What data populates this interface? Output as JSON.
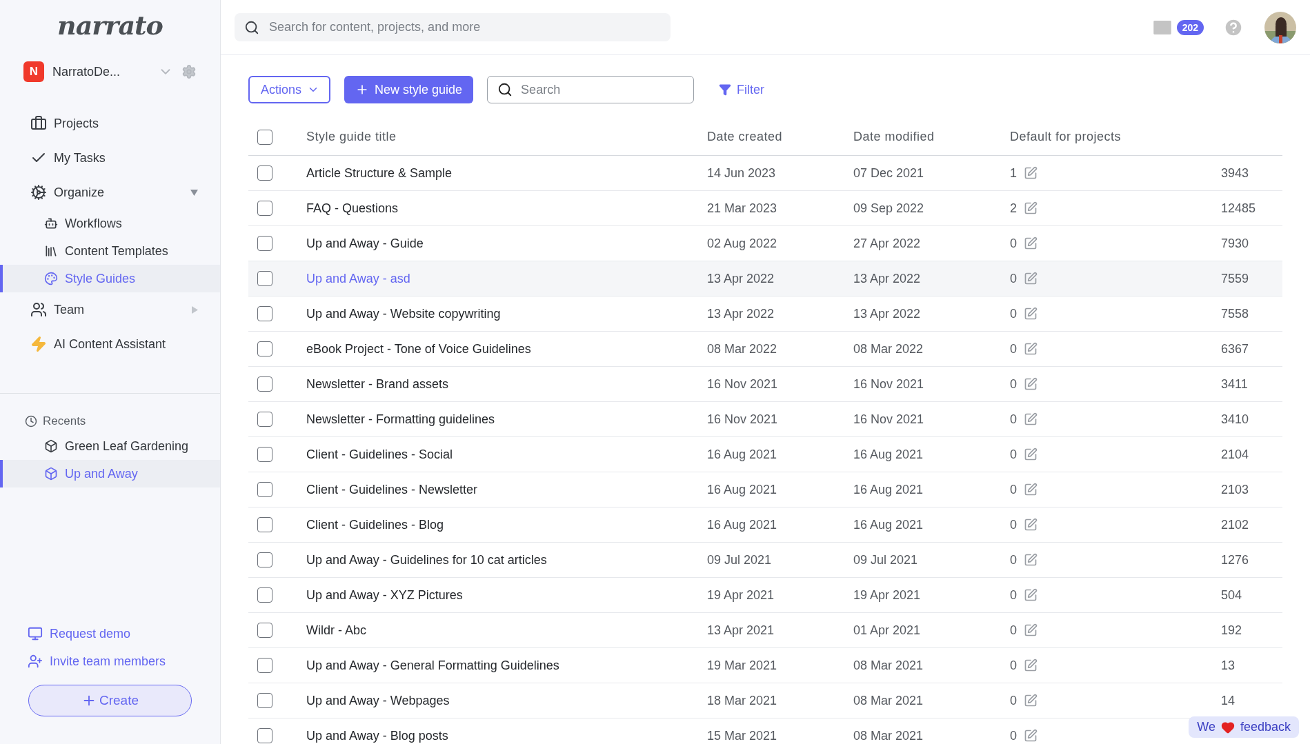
{
  "logo": "narrato",
  "workspace": {
    "initial": "N",
    "name": "NarratoDe..."
  },
  "nav": [
    {
      "kind": "item",
      "label": "Projects",
      "selected": false
    },
    {
      "kind": "item",
      "label": "My Tasks",
      "selected": false
    },
    {
      "kind": "group",
      "label": "Organize",
      "expanded": true,
      "children": [
        {
          "label": "Workflows",
          "selected": false
        },
        {
          "label": "Content Templates",
          "selected": false
        },
        {
          "label": "Style Guides",
          "selected": true
        }
      ]
    },
    {
      "kind": "group",
      "label": "Team",
      "expanded": false
    },
    {
      "kind": "item",
      "label": "AI Content Assistant",
      "selected": false
    }
  ],
  "recents": {
    "title": "Recents",
    "items": [
      {
        "label": "Green Leaf Gardening",
        "selected": false
      },
      {
        "label": "Up and Away",
        "selected": true
      }
    ]
  },
  "links": [
    "Request demo",
    "Invite team members"
  ],
  "create_button": "Create",
  "topbar": {
    "search_placeholder": "Search for content, projects, and more",
    "mail_count": "202"
  },
  "toolbar": {
    "actions": "Actions",
    "new_button": "New style guide",
    "search_placeholder": "Search",
    "filter": "Filter"
  },
  "table": {
    "select_all_checked": false,
    "columns": [
      "Style guide title",
      "Date created",
      "Date modified",
      "Default for projects"
    ],
    "rows": [
      {
        "title": "Article Structure & Sample",
        "created": "14 Jun 2023",
        "modified": "07 Dec 2021",
        "default": "1",
        "column_5": "3943",
        "checked": false,
        "highlighted": false
      },
      {
        "title": "FAQ - Questions",
        "created": "21 Mar 2023",
        "modified": "09 Sep 2022",
        "default": "2",
        "column_5": "12485",
        "checked": false,
        "highlighted": false
      },
      {
        "title": "Up and Away - Guide",
        "created": "02 Aug 2022",
        "modified": "27 Apr 2022",
        "default": "0",
        "column_5": "7930",
        "checked": false,
        "highlighted": false
      },
      {
        "title": "Up and Away - asd",
        "created": "13 Apr 2022",
        "modified": "13 Apr 2022",
        "default": "0",
        "column_5": "7559",
        "checked": false,
        "highlighted": true
      },
      {
        "title": "Up and Away - Website copywriting",
        "created": "13 Apr 2022",
        "modified": "13 Apr 2022",
        "default": "0",
        "column_5": "7558",
        "checked": false,
        "highlighted": false
      },
      {
        "title": "eBook Project - Tone of Voice Guidelines",
        "created": "08 Mar 2022",
        "modified": "08 Mar 2022",
        "default": "0",
        "column_5": "6367",
        "checked": false,
        "highlighted": false
      },
      {
        "title": "Newsletter - Brand assets",
        "created": "16 Nov 2021",
        "modified": "16 Nov 2021",
        "default": "0",
        "column_5": "3411",
        "checked": false,
        "highlighted": false
      },
      {
        "title": "Newsletter - Formatting guidelines",
        "created": "16 Nov 2021",
        "modified": "16 Nov 2021",
        "default": "0",
        "column_5": "3410",
        "checked": false,
        "highlighted": false
      },
      {
        "title": "Client - Guidelines - Social",
        "created": "16 Aug 2021",
        "modified": "16 Aug 2021",
        "default": "0",
        "column_5": "2104",
        "checked": false,
        "highlighted": false
      },
      {
        "title": "Client - Guidelines - Newsletter",
        "created": "16 Aug 2021",
        "modified": "16 Aug 2021",
        "default": "0",
        "column_5": "2103",
        "checked": false,
        "highlighted": false
      },
      {
        "title": "Client - Guidelines - Blog",
        "created": "16 Aug 2021",
        "modified": "16 Aug 2021",
        "default": "0",
        "column_5": "2102",
        "checked": false,
        "highlighted": false
      },
      {
        "title": "Up and Away - Guidelines for 10 cat articles",
        "created": "09 Jul 2021",
        "modified": "09 Jul 2021",
        "default": "0",
        "column_5": "1276",
        "checked": false,
        "highlighted": false
      },
      {
        "title": "Up and Away - XYZ Pictures",
        "created": "19 Apr 2021",
        "modified": "19 Apr 2021",
        "default": "0",
        "column_5": "504",
        "checked": false,
        "highlighted": false
      },
      {
        "title": "Wildr - Abc",
        "created": "13 Apr 2021",
        "modified": "01 Apr 2021",
        "default": "0",
        "column_5": "192",
        "checked": false,
        "highlighted": false
      },
      {
        "title": "Up and Away - General Formatting Guidelines",
        "created": "19 Mar 2021",
        "modified": "08 Mar 2021",
        "default": "0",
        "column_5": "13",
        "checked": false,
        "highlighted": false
      },
      {
        "title": "Up and Away - Webpages",
        "created": "18 Mar 2021",
        "modified": "08 Mar 2021",
        "default": "0",
        "column_5": "14",
        "checked": false,
        "highlighted": false
      },
      {
        "title": "Up and Away - Blog posts",
        "created": "15 Mar 2021",
        "modified": "08 Mar 2021",
        "default": "0",
        "checked": false,
        "highlighted": false
      }
    ]
  },
  "feedback": {
    "before": "We",
    "after": "feedback"
  }
}
